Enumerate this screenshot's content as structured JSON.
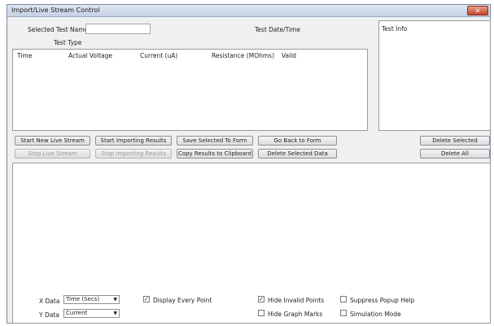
{
  "window": {
    "title": "Import/Live Stream Control",
    "close_glyph": "✕"
  },
  "form": {
    "selected_test_name_label": "Selected Test Name",
    "selected_test_name_value": "",
    "test_type_label": "Test Type",
    "test_date_time_label": "Test Date/Time",
    "test_info_label": "Test Info"
  },
  "table": {
    "columns": [
      "Time",
      "Actual Voltage",
      "Current (uA)",
      "Resistance (MOhms)",
      "Valid"
    ],
    "rows": []
  },
  "buttons": {
    "start_new_live_stream": "Start New Live Stream",
    "start_importing_results": "Start Importing Results",
    "save_selected_to_form": "Save Selected To Form",
    "go_back_to_form": "Go Back to Form",
    "delete_selected": "Delete Selected",
    "stop_live_stream": "Stop Live Stream",
    "stop_importing_results": "Stop Importing Results",
    "copy_results_to_clipboard": "Copy Results to Clipboard",
    "delete_selected_data": "Delete Selected Data",
    "delete_all": "Delete All"
  },
  "graph_options": {
    "x_data_label": "X Data",
    "x_data_value": "Time (Secs)",
    "y_data_label": "Y Data",
    "y_data_value": "Current",
    "display_every_point": {
      "label": "Display Every Point",
      "checked": true
    },
    "hide_invalid_points": {
      "label": "Hide Invalid Points",
      "checked": true
    },
    "hide_graph_marks": {
      "label": "Hide Graph Marks",
      "checked": false
    },
    "suppress_popup_help": {
      "label": "Suppress Popup Help",
      "checked": false
    },
    "simulation_mode": {
      "label": "Simulation Mode",
      "checked": false
    }
  }
}
